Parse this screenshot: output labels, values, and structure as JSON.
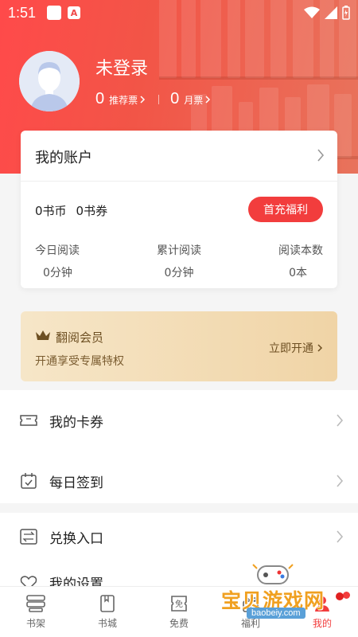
{
  "status_bar": {
    "time": "1:51"
  },
  "profile": {
    "username": "未登录",
    "recommend_tickets": {
      "count": "0",
      "label": "推荐票"
    },
    "monthly_tickets": {
      "count": "0",
      "label": "月票"
    }
  },
  "account": {
    "title": "我的账户",
    "coins": "0书币",
    "vouchers": "0书券",
    "recharge_button": "首充福利",
    "stats": [
      {
        "label": "今日阅读",
        "value": "0分钟"
      },
      {
        "label": "累计阅读",
        "value": "0分钟"
      },
      {
        "label": "阅读本数",
        "value": "0本"
      }
    ]
  },
  "vip": {
    "title": "翻阅会员",
    "description": "开通享受专属特权",
    "cta": "立即开通"
  },
  "menu": {
    "section1": [
      {
        "label": "我的卡券",
        "icon": "ticket-icon"
      },
      {
        "label": "每日签到",
        "icon": "calendar-icon"
      }
    ],
    "section2": [
      {
        "label": "兑换入口",
        "icon": "exchange-icon"
      },
      {
        "label": "我的设置",
        "icon": "heart-icon"
      }
    ]
  },
  "tabbar": {
    "tabs": [
      {
        "label": "书架",
        "icon": "bookshelf-icon"
      },
      {
        "label": "书城",
        "icon": "book-icon"
      },
      {
        "label": "免费",
        "icon": "free-icon"
      },
      {
        "label": "福利",
        "icon": "gift-icon"
      },
      {
        "label": "我的",
        "icon": "user-icon"
      }
    ],
    "active_index": 4
  },
  "watermark": {
    "text": "宝贝游戏网",
    "url": "baobeiy.com"
  },
  "colors": {
    "primary_red": "#f23d3d",
    "header_red": "#ff4a4a",
    "vip_gold": "#f0d4a6"
  }
}
